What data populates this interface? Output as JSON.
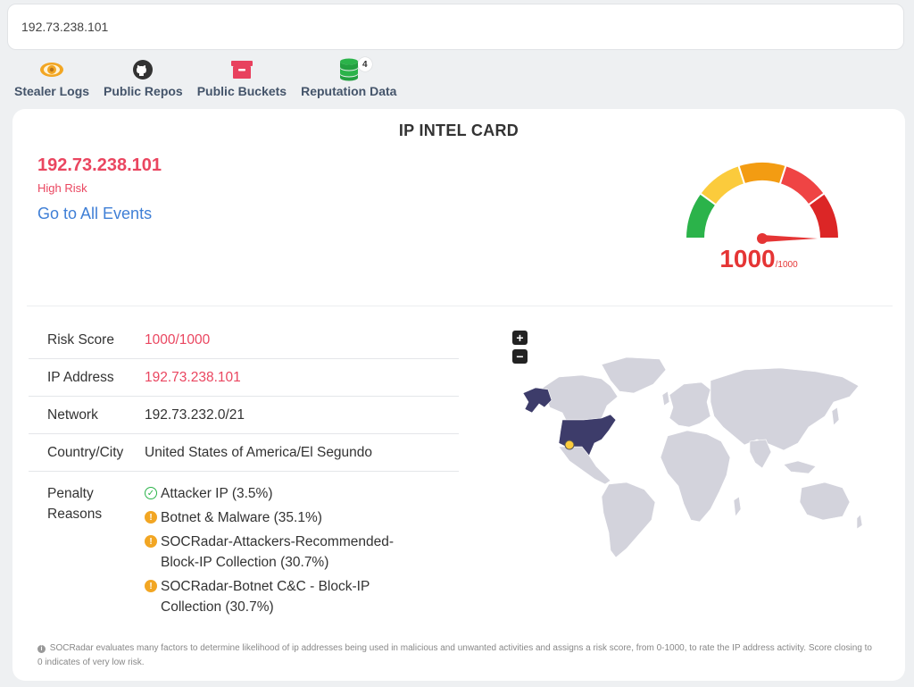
{
  "search": {
    "value": "192.73.238.101"
  },
  "tabs": [
    {
      "label": "Stealer Logs",
      "icon": "eye-icon"
    },
    {
      "label": "Public Repos",
      "icon": "github-icon"
    },
    {
      "label": "Public Buckets",
      "icon": "bucket-icon"
    },
    {
      "label": "Reputation Data",
      "icon": "database-icon",
      "badge": "4"
    }
  ],
  "card": {
    "title": "IP INTEL CARD",
    "ip": "192.73.238.101",
    "risk_level": "High Risk",
    "events_link": "Go to All Events",
    "gauge": {
      "score": "1000",
      "max": "/1000",
      "fraction": 1.0
    },
    "colors": {
      "risk": "#ea4660",
      "link": "#3f7fd6",
      "gauge_green": "#2bb34a",
      "gauge_yellow": "#fbcb3c",
      "gauge_orange": "#f39c12",
      "gauge_red": "#ef4444",
      "gauge_darkred": "#dc2626"
    }
  },
  "details": {
    "risk_score_label": "Risk Score",
    "risk_score_value": "1000/1000",
    "ip_label": "IP Address",
    "ip_value": "192.73.238.101",
    "network_label": "Network",
    "network_value": "192.73.232.0/21",
    "country_label": "Country/City",
    "country_value": "United States of America/El Segundo",
    "penalty_label": "Penalty Reasons",
    "penalties": [
      {
        "text": "Attacker IP (3.5%)",
        "status": "ok"
      },
      {
        "text": "Botnet & Malware (35.1%)",
        "status": "warn"
      },
      {
        "text": "SOCRadar-Attackers-Recommended-Block-IP Collection (30.7%)",
        "status": "warn"
      },
      {
        "text": "SOCRadar-Botnet C&C - Block-IP Collection (30.7%)",
        "status": "warn"
      }
    ]
  },
  "map": {
    "zoom_in": "+",
    "zoom_out": "−",
    "highlight_country": "United States of America",
    "marker_city": "El Segundo"
  },
  "footnote": "SOCRadar evaluates many factors to determine likelihood of ip addresses being used in malicious and unwanted activities and assigns a risk score, from 0-1000, to rate the IP address activity. Score closing to 0 indicates of very low risk."
}
